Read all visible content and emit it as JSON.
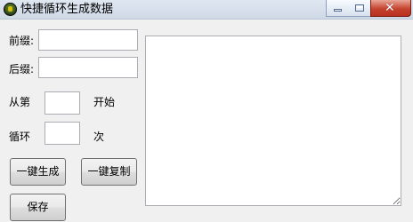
{
  "window": {
    "title": "快捷循环生成数据",
    "app_icon": "app-icon",
    "controls": {
      "minimize": "minimize-icon",
      "maximize": "maximize-icon",
      "close": "close-icon"
    }
  },
  "form": {
    "prefix_label": "前缀:",
    "prefix_value": "",
    "suffix_label": "后缀:",
    "suffix_value": "",
    "start_label_before": "从第",
    "start_value": "",
    "start_label_after": "开始",
    "loop_label_before": "循环",
    "loop_value": "",
    "loop_label_after": "次"
  },
  "buttons": {
    "generate": "一键生成",
    "copy": "一键复制",
    "save": "保存"
  },
  "output": {
    "value": ""
  }
}
